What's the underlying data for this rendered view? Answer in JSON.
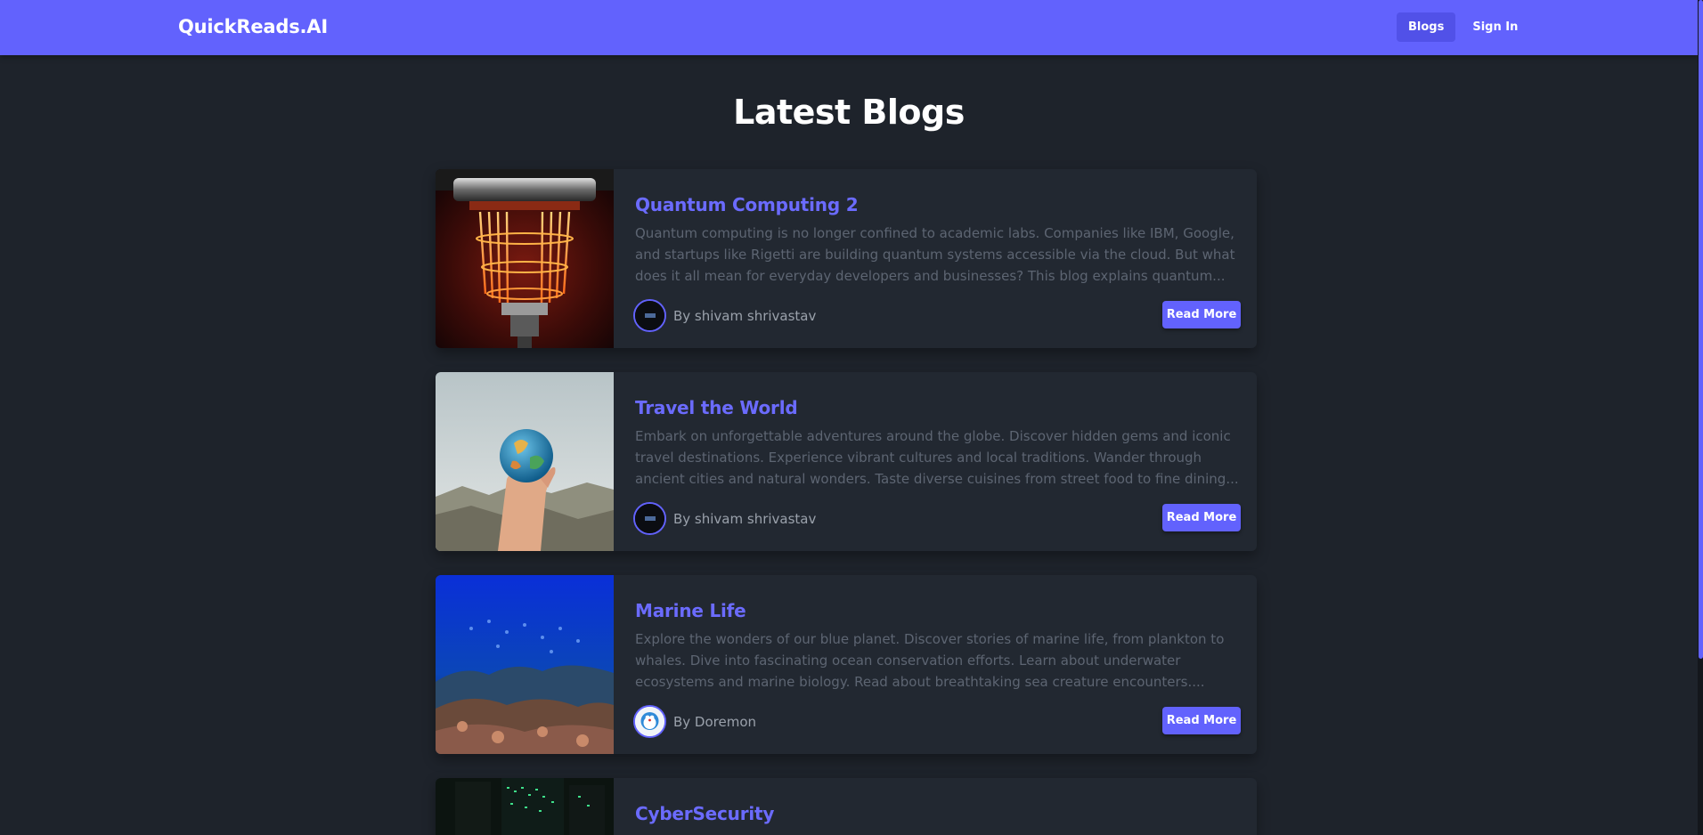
{
  "navbar": {
    "brand": "QuickReads.AI",
    "links": [
      {
        "label": "Blogs",
        "active": true
      },
      {
        "label": "Sign In",
        "active": false
      }
    ]
  },
  "page": {
    "title": "Latest Blogs"
  },
  "blogs": [
    {
      "title": "Quantum Computing 2",
      "excerpt": "Quantum computing is no longer confined to academic labs. Companies like IBM, Google, and startups like Rigetti are building quantum systems accessible via the cloud. But what does it all mean for everyday developers and businesses? This blog explains quantum...",
      "author": "By shivam shrivastav",
      "image_icon": "quantum-computer-image",
      "avatar_icon": "dark-avatar",
      "read_more": "Read More"
    },
    {
      "title": "Travel the World",
      "excerpt": "Embark on unforgettable adventures around the globe. Discover hidden gems and iconic travel destinations. Experience vibrant cultures and local traditions. Wander through ancient cities and natural wonders. Taste diverse cuisines from street food to fine dining...",
      "author": "By shivam shrivastav",
      "image_icon": "globe-in-hand-image",
      "avatar_icon": "dark-avatar",
      "read_more": "Read More"
    },
    {
      "title": "Marine Life",
      "excerpt": "Explore the wonders of our blue planet. Discover stories of marine life, from plankton to whales. Dive into fascinating ocean conservation efforts. Learn about underwater ecosystems and marine biology. Read about breathtaking sea creature encounters....",
      "author": "By Doremon",
      "image_icon": "coral-reef-image",
      "avatar_icon": "doraemon-avatar",
      "read_more": "Read More"
    },
    {
      "title": "CyberSecurity",
      "excerpt": "",
      "author": "",
      "image_icon": "server-room-image",
      "avatar_icon": "",
      "read_more": ""
    }
  ],
  "colors": {
    "primary": "#6262fd",
    "background": "#1e232b",
    "card": "#222831",
    "title_link": "#6b6bff",
    "excerpt": "#5d6572"
  }
}
